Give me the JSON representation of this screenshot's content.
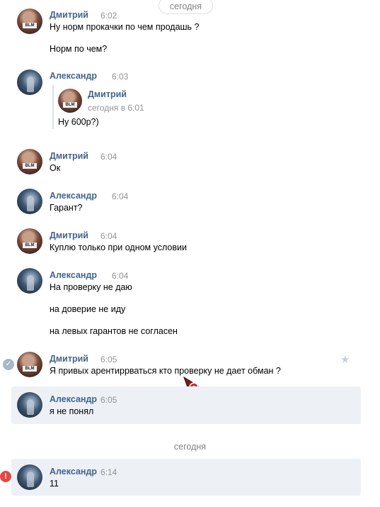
{
  "date_top": "сегодня",
  "date_mid": "сегодня",
  "messages": [
    {
      "name": "Дмитрий",
      "time": "6:02",
      "lines": [
        "Ну норм прокачки по чем продашь ?",
        "Норм по чем?"
      ]
    },
    {
      "name": "Александр",
      "time": "6:03",
      "quote": {
        "name": "Дмитрий",
        "date": "сегодня в 6:01",
        "text": "Ну 600р?)"
      }
    },
    {
      "name": "Дмитрий",
      "time": "6:04",
      "lines": [
        "Ок"
      ]
    },
    {
      "name": "Александр",
      "time": "6:04",
      "lines": [
        "Гарант?"
      ]
    },
    {
      "name": "Дмитрий",
      "time": "6:04",
      "lines": [
        "Куплю только при одном условии"
      ]
    },
    {
      "name": "Александр",
      "time": "6:04",
      "lines": [
        "На проверку не даю",
        "на доверие не иду",
        "на левых гарантов не согласен"
      ]
    },
    {
      "name": "Дмитрий",
      "time": "6:05",
      "lines": [
        "Я привых арентиррваться кто проверку не дает обман ?"
      ]
    },
    {
      "name": "Александр",
      "time": "6:05",
      "lines": [
        "я не понял"
      ]
    },
    {
      "name": "Александр",
      "time": "6:14",
      "lines": [
        "11"
      ]
    }
  ],
  "icons": {
    "selected": "check-icon",
    "favorite": "star-icon",
    "error": "error-icon",
    "cursor": "cursor-icon"
  },
  "colors": {
    "name": "#42648b",
    "time": "#939393",
    "highlight": "#edf0f5",
    "error": "#e64646"
  }
}
